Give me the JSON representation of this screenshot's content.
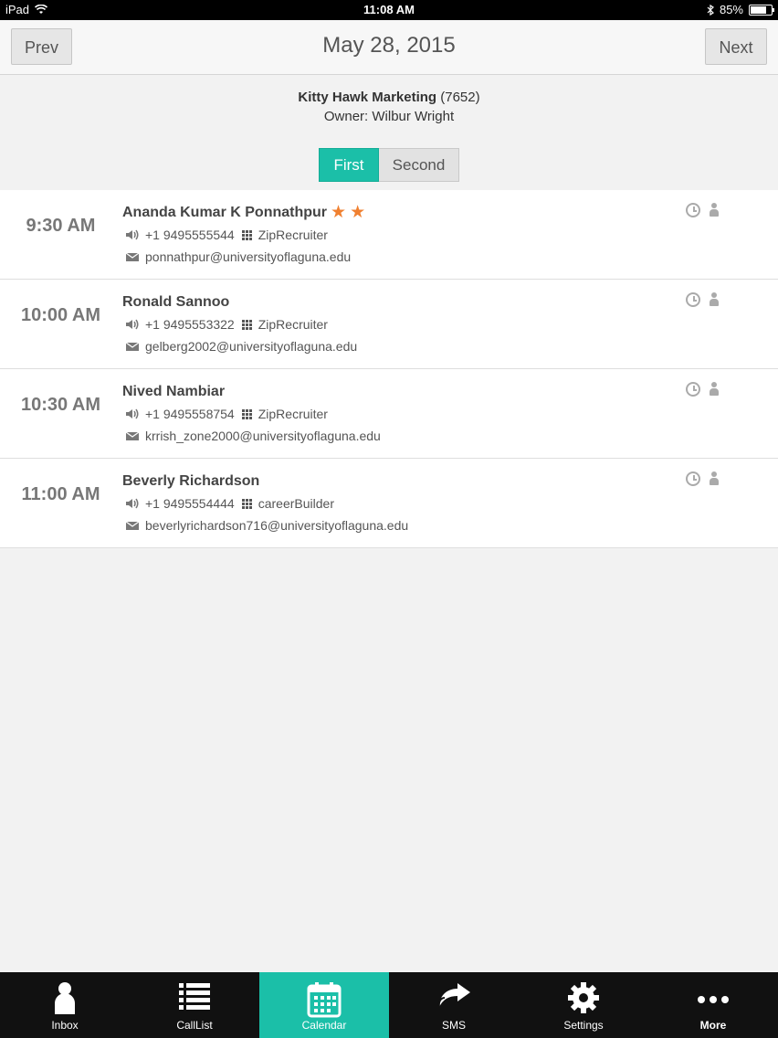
{
  "status_bar": {
    "device": "iPad",
    "time": "11:08 AM",
    "battery": "85%",
    "battery_level": 0.85
  },
  "nav": {
    "prev_label": "Prev",
    "title": "May 28, 2015",
    "next_label": "Next"
  },
  "company": {
    "name": "Kitty Hawk Marketing",
    "id": "(7652)",
    "owner": "Owner: Wilbur Wright"
  },
  "segments": {
    "first": "First",
    "second": "Second",
    "selected": "First"
  },
  "appointments": [
    {
      "time": "9:30 AM",
      "name": "Ananda Kumar K Ponnathpur",
      "stars": 2,
      "phone": "+1 9495555544",
      "source": "ZipRecruiter",
      "email": "ponnathpur@universityoflaguna.edu"
    },
    {
      "time": "10:00 AM",
      "name": "Ronald Sannoo",
      "stars": 0,
      "phone": "+1 9495553322",
      "source": "ZipRecruiter",
      "email": "gelberg2002@universityoflaguna.edu"
    },
    {
      "time": "10:30 AM",
      "name": "Nived Nambiar",
      "stars": 0,
      "phone": "+1 9495558754",
      "source": "ZipRecruiter",
      "email": "krrish_zone2000@universityoflaguna.edu"
    },
    {
      "time": "11:00 AM",
      "name": "Beverly Richardson",
      "stars": 0,
      "phone": "+1 9495554444",
      "source": "careerBuilder",
      "email": "beverlyrichardson716@universityoflaguna.edu"
    }
  ],
  "tabs": [
    {
      "label": "Inbox",
      "icon": "person-icon"
    },
    {
      "label": "CallList",
      "icon": "list-icon"
    },
    {
      "label": "Calendar",
      "icon": "calendar-icon",
      "active": true
    },
    {
      "label": "SMS",
      "icon": "share-arrow-icon"
    },
    {
      "label": "Settings",
      "icon": "gear-icon"
    },
    {
      "label": "More",
      "icon": "more-dots-icon"
    }
  ],
  "colors": {
    "accent": "#1bbfa8",
    "star": "#f08030",
    "tabbar_bg": "#111111"
  }
}
